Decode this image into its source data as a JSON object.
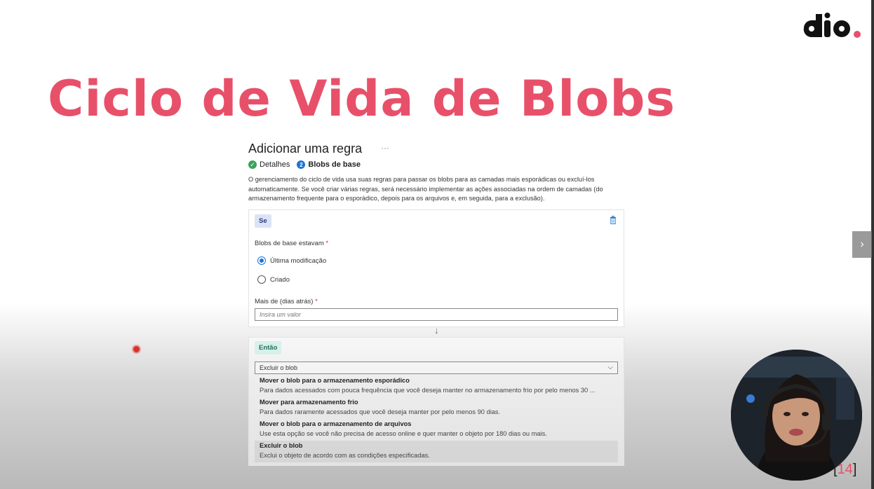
{
  "slide": {
    "title": "Ciclo de Vida de Blobs",
    "logo_name": "dio-logo",
    "page_open": "[",
    "page_number": "14",
    "page_close": "]",
    "accent_color": "#e8506a"
  },
  "panel": {
    "title": "Adicionar uma regra",
    "more": "···",
    "steps": [
      {
        "label": "Detalhes",
        "icon": "check-icon"
      },
      {
        "label": "Blobs de base",
        "number": "2"
      }
    ],
    "description": "O gerenciamento do ciclo de vida usa suas regras para passar os blobs para as camadas mais esporádicas ou excluí-los automaticamente. Se você criar várias regras, será necessário implementar as ações associadas na ordem de camadas (do armazenamento frequente para o esporádico, depois para os arquivos e, em seguida, para a exclusão).",
    "if_block": {
      "tag": "Se",
      "field_label": "Blobs de base estavam",
      "required": "*",
      "options": [
        "Última modificação",
        "Criado"
      ],
      "selected_index": 0,
      "days_label": "Mais de (dias atrás)",
      "days_placeholder": "Insira um valor"
    },
    "then_block": {
      "tag": "Então",
      "selected_value": "Excluir o blob",
      "options": [
        {
          "title": "Mover o blob para o armazenamento esporádico",
          "desc": "Para dados acessados com pouca frequência que você deseja manter no armazenamento frio por pelo menos 30 ..."
        },
        {
          "title": "Mover para armazenamento frio",
          "desc": "Para dados raramente acessados que você deseja manter por pelo menos 90 dias."
        },
        {
          "title": "Mover o blob para o armazenamento de arquivos",
          "desc": "Use esta opção se você não precisa de acesso online e quer manter o objeto por 180 dias ou mais."
        },
        {
          "title": "Excluir o blob",
          "desc": "Exclui o objeto de acordo com as condições especificadas."
        }
      ]
    }
  },
  "controls": {
    "next_icon": "chevron-right-icon"
  }
}
